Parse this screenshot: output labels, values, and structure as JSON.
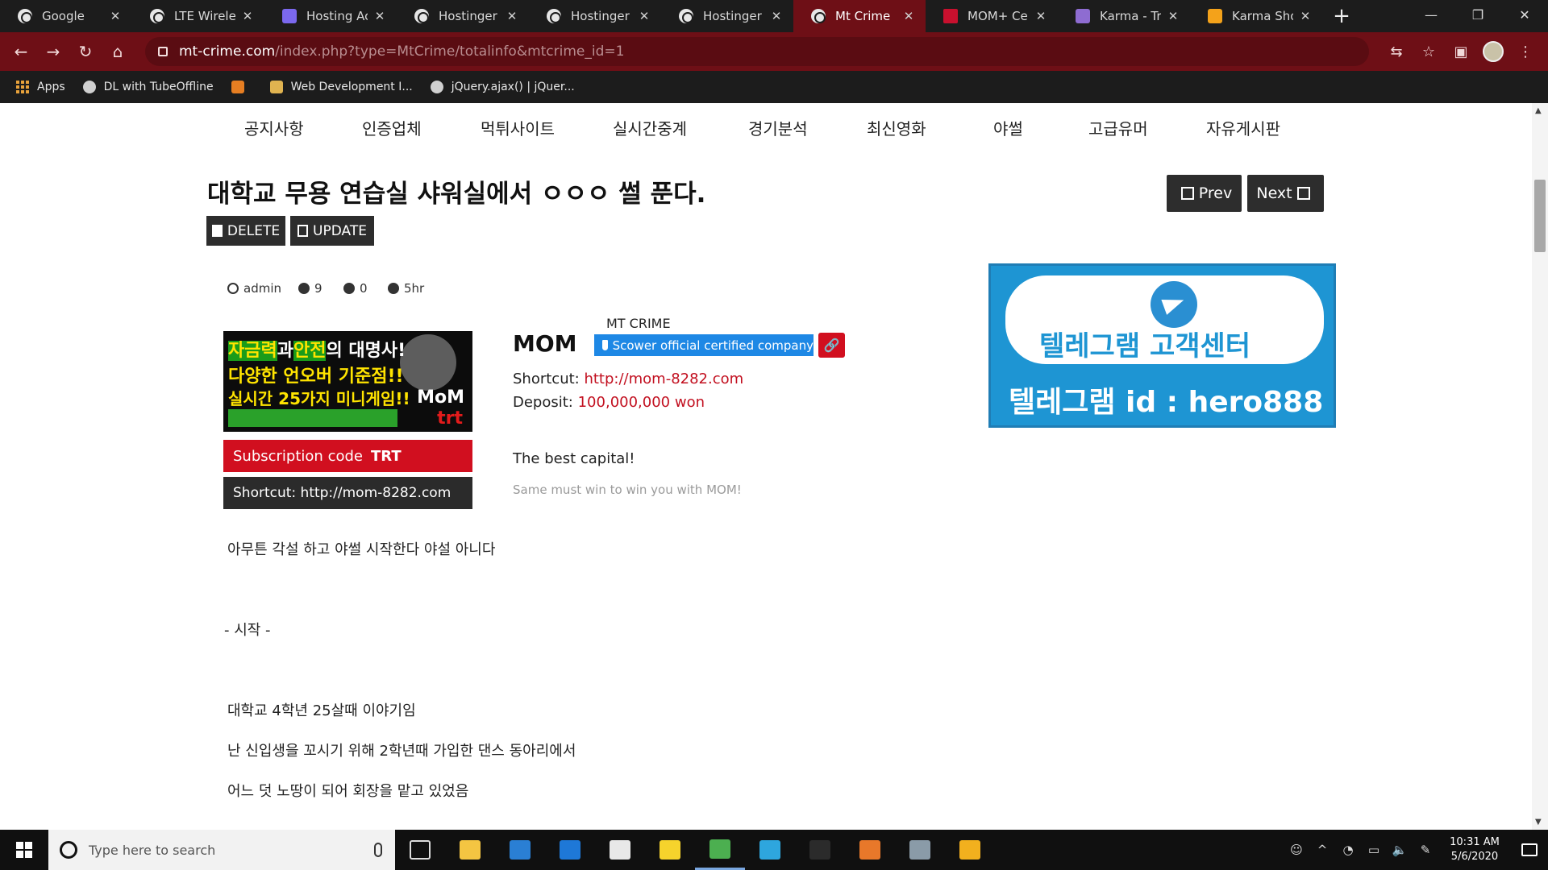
{
  "browser": {
    "tabs": [
      {
        "title": "Google",
        "icon": "google-icon",
        "favclass": "g"
      },
      {
        "title": "LTE Wireles",
        "icon": "globe-icon",
        "favclass": "g"
      },
      {
        "title": "Hosting Ac",
        "icon": "hostinger-icon",
        "favclass": "hostinger"
      },
      {
        "title": "Hostinger I",
        "icon": "globe-icon",
        "favclass": "g"
      },
      {
        "title": "Hostinger I",
        "icon": "globe-icon",
        "favclass": "g"
      },
      {
        "title": "Hostinger I",
        "icon": "globe-icon",
        "favclass": "g"
      },
      {
        "title": "Mt Crime",
        "icon": "globe-icon",
        "favclass": "g",
        "active": true
      },
      {
        "title": "MOM+ Cer",
        "icon": "mom-icon",
        "favclass": "mom"
      },
      {
        "title": "Karma - Tr",
        "icon": "karma-icon",
        "favclass": "karma"
      },
      {
        "title": "Karma Shop",
        "icon": "karma-shop-icon",
        "favclass": "karmashop"
      }
    ],
    "url_host": "mt-crime.com",
    "url_path": "/index.php?type=MtCrime/totalinfo&mtcrime_id=1",
    "bookmarks": [
      "Apps",
      "DL with TubeOffline",
      "",
      "Web Development I...",
      "jQuery.ajax() | jQuer..."
    ]
  },
  "site": {
    "nav": [
      "공지사항",
      "인증업체",
      "먹튀사이트",
      "실시간중계",
      "경기분석",
      "최신영화",
      "야썰",
      "고급유머",
      "자유게시판"
    ],
    "post_title": "대학교 무용 연습실 샤워실에서 ㅇㅇㅇ 썰 푼다.",
    "prev_label": "Prev",
    "next_label": "Next",
    "delete_label": "DELETE",
    "update_label": "UPDATE",
    "meta": {
      "author": "admin",
      "views": "9",
      "comments": "0",
      "time": "5hr"
    },
    "banner": {
      "line1a": "자금력",
      "line1b": "과",
      "line1c": "안전",
      "line1d": "의 대명사!",
      "line2": "다양한 언오버 기준점!!",
      "line3": "실시간 25가지 미니게임!!",
      "logo_top": "MoM",
      "logo_bottom": "trt"
    },
    "subscription_label": "Subscription code",
    "subscription_code": "TRT",
    "shortcut_box": "Shortcut: http://mom-8282.com",
    "company_name": "MOM",
    "mt_crime_label": "MT CRIME",
    "certified_label": "Scower official certified company",
    "shortcut_label": "Shortcut:",
    "shortcut_url": "http://mom-8282.com",
    "deposit_label": "Deposit:",
    "deposit_value": "100,000,000 won",
    "tagline": "The best capital!",
    "tagline_sub": "Same must win to win you with MOM!",
    "ad": {
      "line1": "텔레그램 고객센터",
      "line2": "텔레그램 id : hero888"
    },
    "body": [
      "아무튼 각설 하고 야썰 시작한다 야설 아니다",
      "- 시작 -",
      "대학교 4학년 25살때 이야기임",
      "난 신입생을 꼬시기 위해 2학년때 가입한 댄스 동아리에서",
      "어느 덧 노땅이 되어 회장을 맡고 있었음"
    ]
  },
  "taskbar": {
    "search_placeholder": "Type here to search",
    "time": "10:31 AM",
    "date": "5/6/2020",
    "pinned": [
      {
        "name": "task-view-icon",
        "color": "#101010"
      },
      {
        "name": "file-explorer-icon",
        "color": "#f4c542"
      },
      {
        "name": "mail-icon",
        "color": "#2a7fd4"
      },
      {
        "name": "edge-icon",
        "color": "#1e78d7"
      },
      {
        "name": "store-icon",
        "color": "#e8e8e8"
      },
      {
        "name": "sticky-notes-icon",
        "color": "#f6d32c"
      },
      {
        "name": "chrome-icon",
        "color": "#4caf50",
        "active": true
      },
      {
        "name": "telegram-icon",
        "color": "#2ea6de"
      },
      {
        "name": "terminal-icon",
        "color": "#2b2b2b"
      },
      {
        "name": "sublime-icon",
        "color": "#e8782a"
      },
      {
        "name": "settings-icon",
        "color": "#8a9ba8"
      },
      {
        "name": "chrome-alt-icon",
        "color": "#f2b01e"
      }
    ]
  }
}
